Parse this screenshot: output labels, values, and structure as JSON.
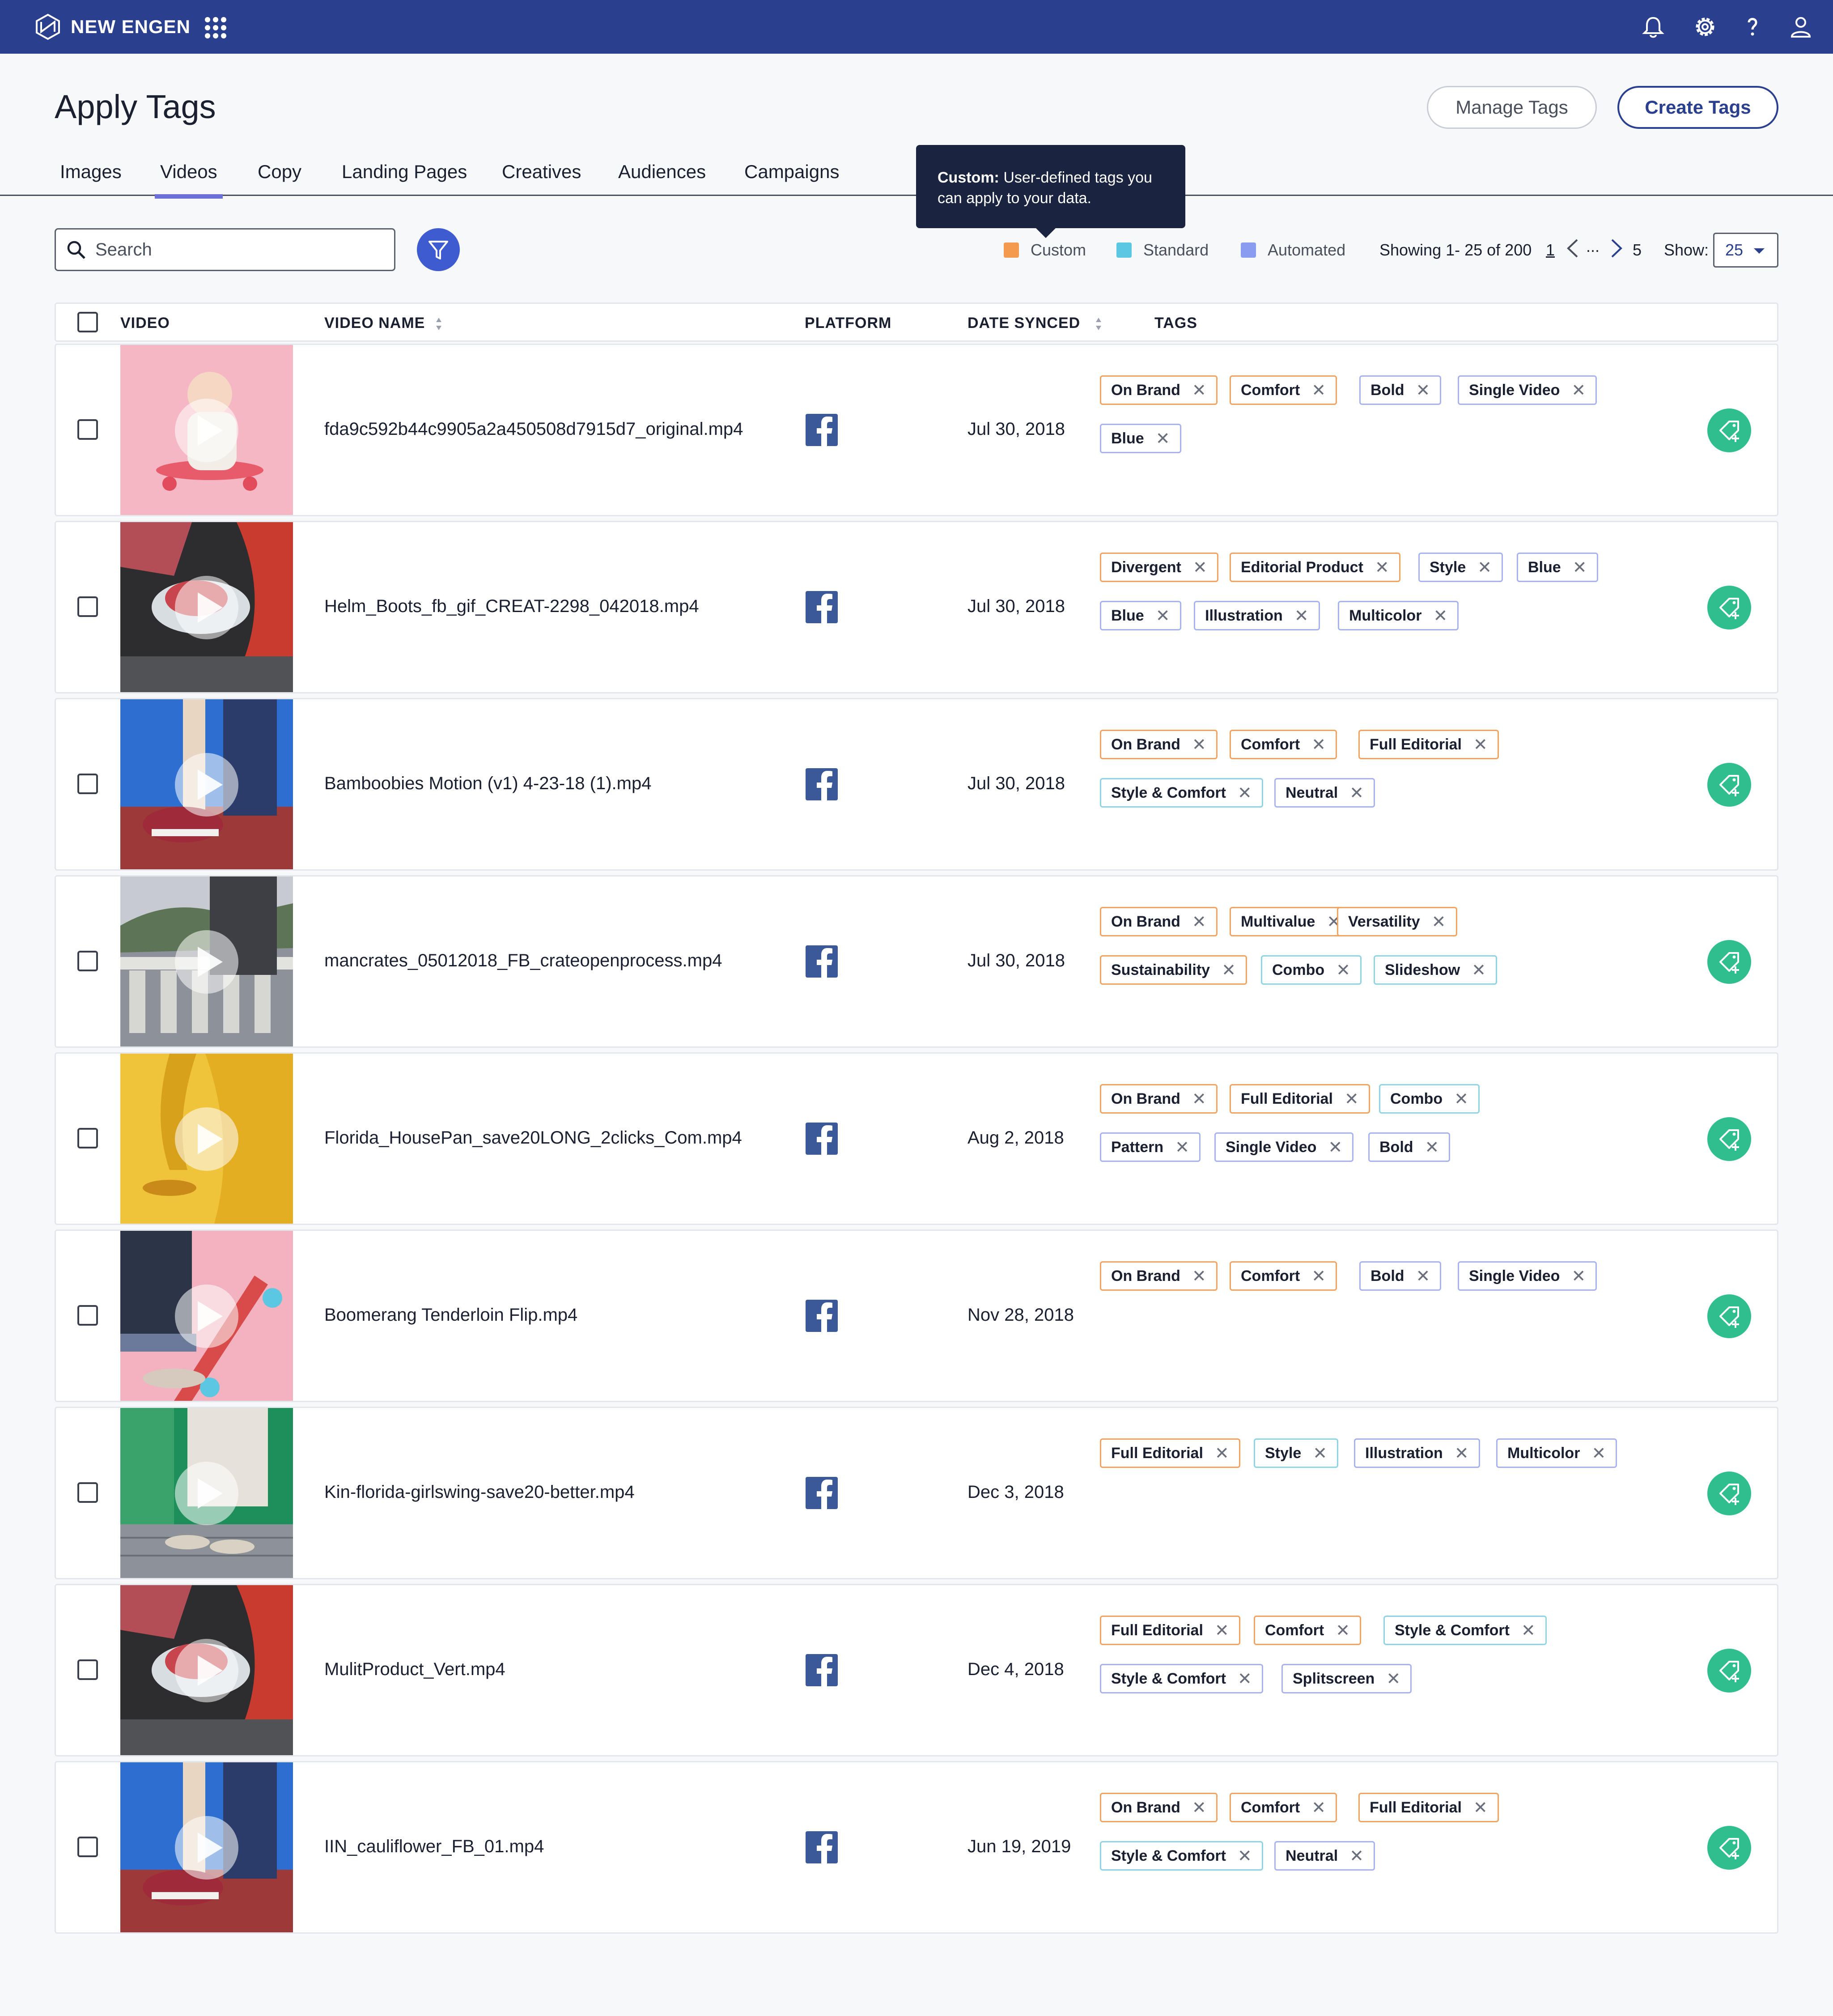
{
  "app": {
    "brand": "NEW ENGEN",
    "colors": {
      "nav": "#2a3f8d",
      "custom": "#f39a4e",
      "standard": "#5bc7e0",
      "automated": "#8a9cf0",
      "add_button": "#2fbf8f"
    },
    "icons": [
      "logo-icon",
      "apps-grid-icon",
      "bell-icon",
      "gear-icon",
      "help-icon",
      "user-icon"
    ]
  },
  "header": {
    "title": "Apply Tags",
    "manage_label": "Manage Tags",
    "create_label": "Create Tags"
  },
  "tabs": [
    {
      "label": "Images"
    },
    {
      "label": "Videos",
      "active": true
    },
    {
      "label": "Copy"
    },
    {
      "label": "Landing Pages"
    },
    {
      "label": "Creatives"
    },
    {
      "label": "Audiences"
    },
    {
      "label": "Campaigns"
    }
  ],
  "tooltip": {
    "title": "Custom:",
    "text": " User-defined tags you can apply to your data."
  },
  "toolbar": {
    "search_placeholder": "Search",
    "legend": [
      {
        "label": "Custom",
        "color": "#f39a4e"
      },
      {
        "label": "Standard",
        "color": "#5bc7e0"
      },
      {
        "label": "Automated",
        "color": "#8a9cf0"
      }
    ],
    "showing": "Showing 1- 25 of 200",
    "page_current": "1",
    "page_ellipsis": "...",
    "page_last": "5",
    "show_label": "Show:",
    "show_value": "25"
  },
  "table": {
    "columns": [
      "VIDEO",
      "VIDEO NAME",
      "PLATFORM",
      "DATE SYNCED",
      "TAGS"
    ],
    "rows": [
      {
        "name": "fda9c592b44c9905a2a450508d7915d7_original.mp4",
        "date": "Jul 30, 2018",
        "thumb": "pink",
        "tags": [
          {
            "label": "On Brand",
            "type": "custom"
          },
          {
            "label": "Comfort",
            "type": "custom"
          },
          {
            "label": "Bold",
            "type": "automated"
          },
          {
            "label": "Single Video",
            "type": "automated"
          },
          {
            "label": "Blue",
            "type": "automated"
          }
        ]
      },
      {
        "name": "Helm_Boots_fb_gif_CREAT-2298_042018.mp4",
        "date": "Jul 30, 2018",
        "thumb": "red",
        "tags": [
          {
            "label": "Divergent",
            "type": "custom"
          },
          {
            "label": "Editorial Product",
            "type": "custom"
          },
          {
            "label": "Style",
            "type": "automated"
          },
          {
            "label": "Blue",
            "type": "automated"
          },
          {
            "label": "Blue",
            "type": "automated"
          },
          {
            "label": "Illustration",
            "type": "automated"
          },
          {
            "label": "Multicolor",
            "type": "automated"
          }
        ]
      },
      {
        "name": "Bamboobies Motion (v1) 4-23-18 (1).mp4",
        "date": "Jul 30, 2018",
        "thumb": "sky",
        "tags": [
          {
            "label": "On Brand",
            "type": "custom"
          },
          {
            "label": "Comfort",
            "type": "custom"
          },
          {
            "label": "Full Editorial",
            "type": "custom"
          },
          {
            "label": "Style & Comfort",
            "type": "standard"
          },
          {
            "label": "Neutral",
            "type": "automated"
          }
        ]
      },
      {
        "name": "mancrates_05012018_FB_crateopenprocess.mp4",
        "date": "Jul 30, 2018",
        "thumb": "gray",
        "tags": [
          {
            "label": "On Brand",
            "type": "custom"
          },
          {
            "label": "Multivalue",
            "type": "custom"
          },
          {
            "label": "Versatility",
            "type": "custom"
          },
          {
            "label": "Sustainability",
            "type": "custom"
          },
          {
            "label": "Combo",
            "type": "standard"
          },
          {
            "label": "Slideshow",
            "type": "standard"
          }
        ]
      },
      {
        "name": "Florida_HousePan_save20LONG_2clicks_Com.mp4",
        "date": "Aug 2, 2018",
        "thumb": "yellow",
        "tags": [
          {
            "label": "On Brand",
            "type": "custom"
          },
          {
            "label": "Full Editorial",
            "type": "custom"
          },
          {
            "label": "Combo",
            "type": "standard"
          },
          {
            "label": "Pattern",
            "type": "automated"
          },
          {
            "label": "Single Video",
            "type": "automated"
          },
          {
            "label": "Bold",
            "type": "automated"
          }
        ]
      },
      {
        "name": "Boomerang Tenderloin Flip.mp4",
        "date": "Nov 28, 2018",
        "thumb": "pink2",
        "tags": [
          {
            "label": "On Brand",
            "type": "custom"
          },
          {
            "label": "Comfort",
            "type": "custom"
          },
          {
            "label": "Bold",
            "type": "automated"
          },
          {
            "label": "Single Video",
            "type": "automated"
          }
        ]
      },
      {
        "name": "Kin-florida-girlswing-save20-better.mp4",
        "date": "Dec 3, 2018",
        "thumb": "green",
        "tags": [
          {
            "label": "Full Editorial",
            "type": "custom"
          },
          {
            "label": "Style",
            "type": "standard"
          },
          {
            "label": "Illustration",
            "type": "automated"
          },
          {
            "label": "Multicolor",
            "type": "automated"
          }
        ]
      },
      {
        "name": "MulitProduct_Vert.mp4",
        "date": "Dec 4, 2018",
        "thumb": "red",
        "tags": [
          {
            "label": "Full Editorial",
            "type": "custom"
          },
          {
            "label": "Comfort",
            "type": "custom"
          },
          {
            "label": "Style & Comfort",
            "type": "standard"
          },
          {
            "label": "Style & Comfort",
            "type": "automated"
          },
          {
            "label": "Splitscreen",
            "type": "automated"
          }
        ]
      },
      {
        "name": "IIN_cauliflower_FB_01.mp4",
        "date": "Jun 19, 2019",
        "thumb": "sky",
        "tags": [
          {
            "label": "On Brand",
            "type": "custom"
          },
          {
            "label": "Comfort",
            "type": "custom"
          },
          {
            "label": "Full Editorial",
            "type": "custom"
          },
          {
            "label": "Style & Comfort",
            "type": "standard"
          },
          {
            "label": "Neutral",
            "type": "automated"
          }
        ]
      }
    ]
  }
}
